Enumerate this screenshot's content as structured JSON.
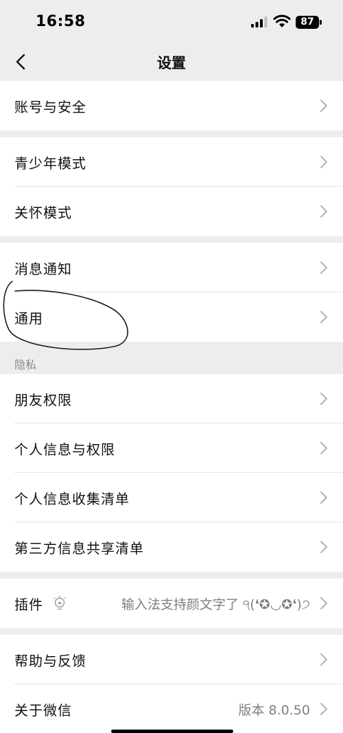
{
  "status_bar": {
    "time": "16:58",
    "battery": "87"
  },
  "nav": {
    "title": "设置",
    "back_icon": "chevron-left-icon"
  },
  "groups": {
    "account": [
      {
        "label": "账号与安全"
      }
    ],
    "modes": [
      {
        "label": "青少年模式"
      },
      {
        "label": "关怀模式"
      }
    ],
    "general": [
      {
        "label": "消息通知"
      },
      {
        "label": "通用"
      }
    ],
    "privacy": {
      "header": "隐私",
      "items": [
        {
          "label": "朋友权限"
        },
        {
          "label": "个人信息与权限"
        },
        {
          "label": "个人信息收集清单"
        },
        {
          "label": "第三方信息共享清单"
        }
      ]
    },
    "plugins": [
      {
        "label": "插件",
        "value": "输入法支持颜文字了 ੧(❛✪◡✪❛)੭",
        "icon": "lightbulb-icon"
      }
    ],
    "about": [
      {
        "label": "帮助与反馈"
      },
      {
        "label": "关于微信",
        "value": "版本 8.0.50"
      }
    ]
  },
  "colors": {
    "background": "#ededed",
    "row_background": "#ffffff",
    "chevron": "#b2b2b2",
    "secondary_text": "#7f7f7f"
  }
}
